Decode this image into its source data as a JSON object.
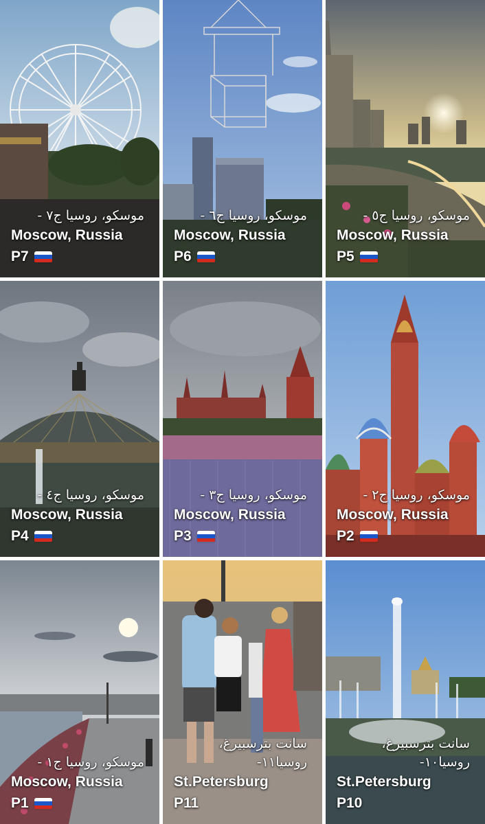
{
  "tiles": [
    {
      "id": "p7",
      "arabic": "موسكو، روسيا ج٧ -",
      "english": "Moscow, Russia",
      "code": "P7",
      "flag": "russia-flag-icon"
    },
    {
      "id": "p6",
      "arabic": "موسكو، روسيا ج٦ -",
      "english": "Moscow, Russia",
      "code": "P6",
      "flag": "russia-flag-icon"
    },
    {
      "id": "p5",
      "arabic": "موسكو، روسيا ج٥ -",
      "english": "Moscow, Russia",
      "code": "P5",
      "flag": "russia-flag-icon"
    },
    {
      "id": "p4",
      "arabic": "موسكو، روسيا ج٤ -",
      "english": "Moscow, Russia",
      "code": "P4",
      "flag": "russia-flag-icon"
    },
    {
      "id": "p3",
      "arabic": "موسكو، روسيا ج٣ -",
      "english": "Moscow, Russia",
      "code": "P3",
      "flag": "russia-flag-icon"
    },
    {
      "id": "p2",
      "arabic": "موسكو، روسيا ج٢ -",
      "english": "Moscow, Russia",
      "code": "P2",
      "flag": "russia-flag-icon"
    },
    {
      "id": "p1",
      "arabic": "موسكو، روسيا ج١ -",
      "english": "Moscow, Russia",
      "code": "P1",
      "flag": "russia-flag-icon"
    },
    {
      "id": "p11",
      "arabic_line1": "سانت بترسبيرغ،",
      "arabic_line2": "روسيا١١-",
      "english": "St.Petersburg",
      "code": "P11"
    },
    {
      "id": "p10",
      "arabic_line1": "سانت بترسبيرغ،",
      "arabic_line2": "روسيا١٠-",
      "english": "St.Petersburg",
      "code": "P10"
    }
  ],
  "flag_colors": {
    "white": "#ffffff",
    "blue": "#1c57c9",
    "red": "#d52b1e"
  }
}
